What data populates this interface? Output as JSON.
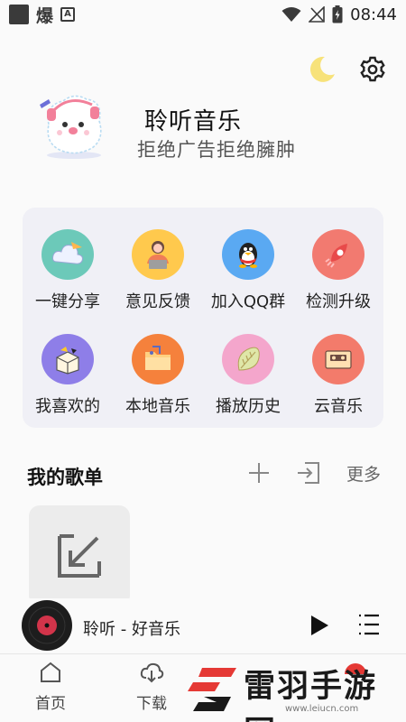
{
  "status_bar": {
    "char": "爆",
    "badge": "A",
    "time": "08:44"
  },
  "profile": {
    "title": "聆听音乐",
    "slogan": "拒绝广告拒绝臃肿"
  },
  "grid": [
    {
      "label": "一键分享",
      "icon": "share-cloud-icon",
      "color": "#6cc9b9"
    },
    {
      "label": "意见反馈",
      "icon": "feedback-person-icon",
      "color": "#ffc94d"
    },
    {
      "label": "加入QQ群",
      "icon": "qq-penguin-icon",
      "color": "#5aa9f2"
    },
    {
      "label": "检测升级",
      "icon": "rocket-icon",
      "color": "#f27a70"
    },
    {
      "label": "我喜欢的",
      "icon": "favorites-box-icon",
      "color": "#8e7ee8"
    },
    {
      "label": "本地音乐",
      "icon": "local-folder-icon",
      "color": "#f5813c"
    },
    {
      "label": "播放历史",
      "icon": "history-leaf-icon",
      "color": "#f4a6cc"
    },
    {
      "label": "云音乐",
      "icon": "cassette-icon",
      "color": "#f37b6b"
    }
  ],
  "playlist": {
    "title": "我的歌单",
    "more": "更多"
  },
  "player": {
    "song": "聆听 - 好音乐"
  },
  "nav": {
    "home": "首页",
    "download": "下载"
  },
  "watermark": {
    "text": "雷羽手游网",
    "url": "www.leiucn.com"
  },
  "colors": {
    "accent_red": "#e53935",
    "background": "#fafafa",
    "card": "#f0f0f6"
  }
}
